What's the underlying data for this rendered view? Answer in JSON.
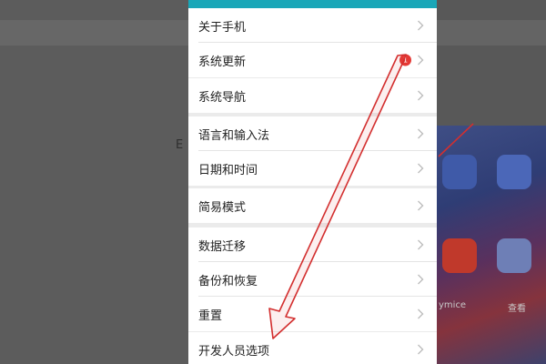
{
  "background": {
    "left_fragment": "E",
    "right_labels": [
      "ymice",
      "查看"
    ]
  },
  "settings": {
    "groups": [
      {
        "items": [
          {
            "label": "关于手机",
            "icon": "chevron-right-icon"
          },
          {
            "label": "系统更新",
            "icon": "chevron-right-icon",
            "badge": "1"
          }
        ]
      },
      {
        "items": [
          {
            "label": "系统导航",
            "icon": "chevron-right-icon"
          }
        ]
      },
      {
        "items": [
          {
            "label": "语言和输入法",
            "icon": "chevron-right-icon"
          },
          {
            "label": "日期和时间",
            "icon": "chevron-right-icon"
          }
        ]
      },
      {
        "items": [
          {
            "label": "简易模式",
            "icon": "chevron-right-icon"
          }
        ]
      },
      {
        "items": [
          {
            "label": "数据迁移",
            "icon": "chevron-right-icon"
          },
          {
            "label": "备份和恢复",
            "icon": "chevron-right-icon"
          },
          {
            "label": "重置",
            "icon": "chevron-right-icon"
          }
        ]
      },
      {
        "items": [
          {
            "label": "开发人员选项",
            "icon": "chevron-right-icon"
          }
        ]
      }
    ]
  },
  "colors": {
    "accent": "#1aa7b8",
    "badge": "#e53935",
    "annotation_arrow": "#d32f2f"
  },
  "annotation": {
    "type": "arrow",
    "icon": "annotation-arrow-icon"
  }
}
